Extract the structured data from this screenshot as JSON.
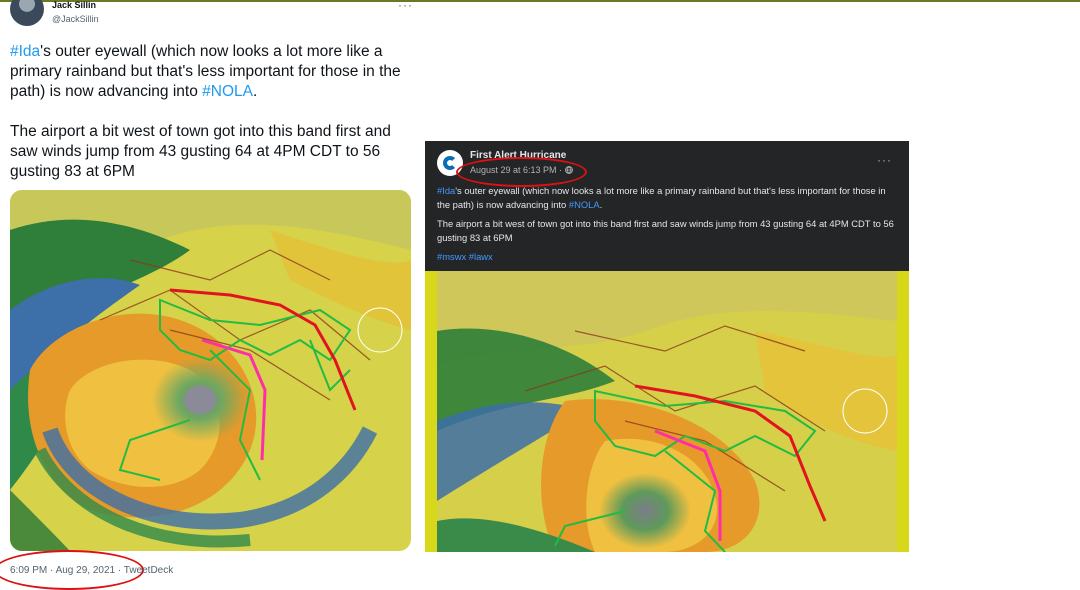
{
  "tweet": {
    "author_name": "Jack Sillin",
    "author_handle": "@JackSillin",
    "more_label": "···",
    "text_p1_tag1": "#Ida",
    "text_p1_mid": "'s outer eyewall (which now looks a lot more like a primary rainband but that's less important for those in the path) is now advancing into ",
    "text_p1_tag2": "#NOLA",
    "text_p1_end": ".",
    "text_p2": "The airport a bit west of town got into this band first and saw winds jump from 43 gusting 64 at 4PM CDT to 56 gusting 83 at 6PM",
    "timestamp": "6:09 PM · Aug 29, 2021 · TweetDeck"
  },
  "facebook_post": {
    "page_name": "First Alert Hurricane",
    "time": "August 29 at 6:13 PM · ",
    "globe_icon": "globe-icon",
    "more_label": "···",
    "text_p1_tag1": "#Ida",
    "text_p1_mid": "'s outer eyewall (which now looks a lot more like a primary rainband but that's less important for those in the path) is now advancing into ",
    "text_p1_tag2": "#NOLA",
    "text_p1_end": ".",
    "text_p2": "The airport a bit west of town got into this band first and saw winds jump from 43 gusting 64 at 4PM CDT to 56 gusting 83 at 6PM",
    "hashtags": "#mswx #lawx"
  },
  "colors": {
    "link": "#1d9bf0",
    "annotation": "#dd1111",
    "fb_background": "#242526"
  }
}
